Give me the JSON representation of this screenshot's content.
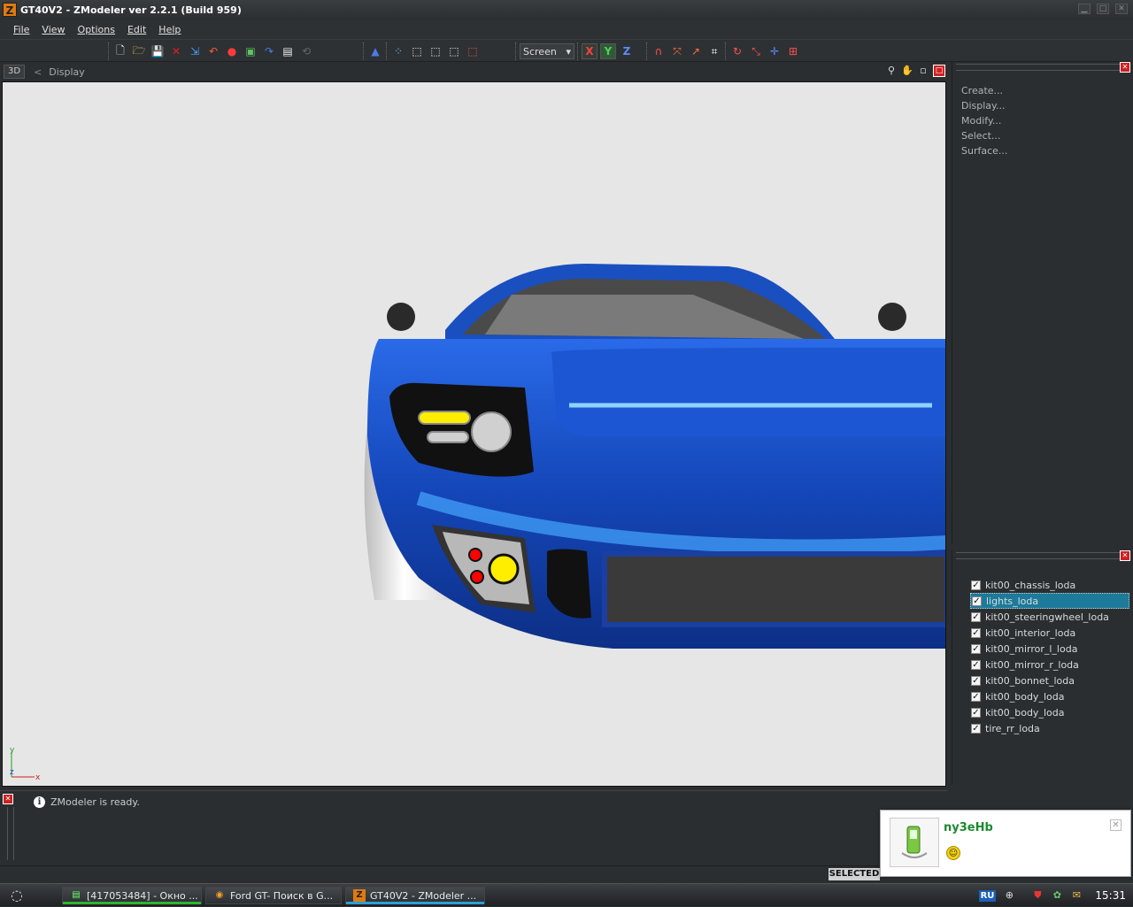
{
  "window": {
    "title": "GT40V2 - ZModeler ver 2.2.1 (Build 959)",
    "logo": "Z"
  },
  "menu": [
    "File",
    "View",
    "Options",
    "Edit",
    "Help"
  ],
  "toolbar": {
    "screen_select": "Screen",
    "axis_x": "X",
    "axis_y": "Y",
    "axis_z": "Z"
  },
  "viewport_header": {
    "mode": "3D",
    "back": "<",
    "label": "Display"
  },
  "viewport": {
    "axis_y": "y",
    "axis_x": "x",
    "axis_z": "z",
    "background": "#e6e6e6",
    "car_color": "#1f5bd0"
  },
  "commands": [
    "Create...",
    "Display...",
    "Modify...",
    "Select...",
    "Surface..."
  ],
  "objects": [
    {
      "label": "kit00_chassis_loda",
      "checked": true
    },
    {
      "label": "lights_loda",
      "checked": true,
      "selected": true
    },
    {
      "label": "kit00_steeringwheel_loda",
      "checked": true
    },
    {
      "label": "kit00_interior_loda",
      "checked": true
    },
    {
      "label": "kit00_mirror_l_loda",
      "checked": true
    },
    {
      "label": "kit00_mirror_r_loda",
      "checked": true
    },
    {
      "label": "kit00_bonnet_loda",
      "checked": true
    },
    {
      "label": "kit00_body_loda",
      "checked": true
    },
    {
      "label": "kit00_body_loda",
      "checked": true
    },
    {
      "label": "tire_rr_loda",
      "checked": true
    }
  ],
  "status": {
    "message": "ZModeler is ready.",
    "selected": "SELECTED"
  },
  "taskbar": {
    "tasks": [
      {
        "label": "[417053484] - Окно ...",
        "accent": "#2fb52f"
      },
      {
        "label": "Ford GT- Поиск в G...",
        "accent": "#888888"
      },
      {
        "label": "GT40V2 - ZModeler ...",
        "accent": "#2a9fd6"
      }
    ],
    "lang": "RU",
    "clock": "15:31"
  },
  "notification": {
    "name": "ny3eHb"
  }
}
